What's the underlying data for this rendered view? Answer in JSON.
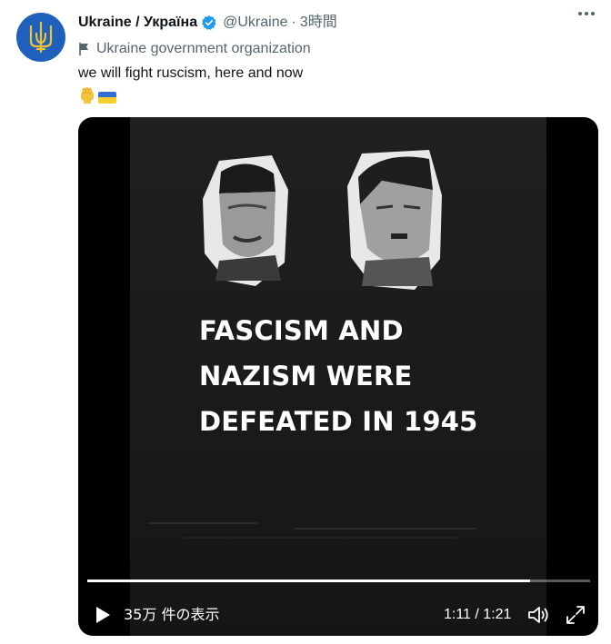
{
  "account": {
    "display_name": "Ukraine / Україна",
    "handle": "@Ukraine",
    "separator": "·",
    "time": "3時間",
    "affiliation": "Ukraine government organization",
    "avatar_icon": "trident-icon",
    "verified_color": "#1d9bf0"
  },
  "tweet": {
    "text": "we will fight ruscism, here and now",
    "emojis": [
      "raised-fist-emoji",
      "ukraine-flag-emoji"
    ]
  },
  "video": {
    "caption_lines": [
      "FASCISM AND",
      "NAZISM WERE",
      "DEFEATED IN 1945"
    ],
    "views": "35万 件の表示",
    "timecode": "1:11 / 1:21",
    "progress": 0.88
  },
  "colors": {
    "accent": "#1d9bf0",
    "avatar_bg": "#1f60bd",
    "trident": "#f2c230",
    "flag_blue": "#2f6fd6",
    "flag_yellow": "#f7d02c"
  }
}
